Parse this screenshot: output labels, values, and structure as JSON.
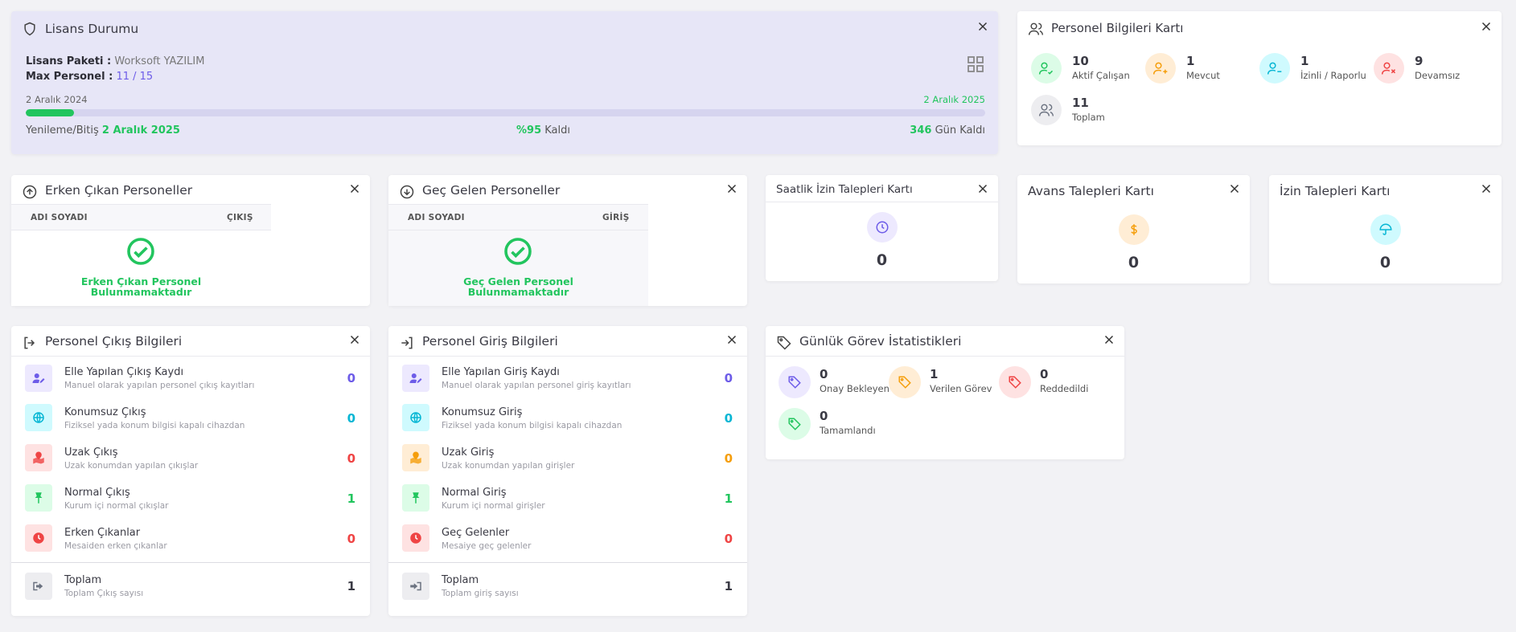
{
  "license": {
    "title": "Lisans Durumu",
    "package_label": "Lisans Paketi :",
    "package_value": "Worksoft YAZILIM",
    "max_label": "Max Personel :",
    "max_value": "11 / 15",
    "start_date": "2 Aralık 2024",
    "end_date": "2 Aralık 2025",
    "progress_fraction": 0.05,
    "renew_label": "Yenileme/Bitiş",
    "renew_date": "2 Aralık 2025",
    "pct_value": "%95",
    "pct_label": "Kaldı",
    "days_value": "346",
    "days_label": "Gün Kaldı"
  },
  "personnel": {
    "title": "Personel Bilgileri Kartı",
    "stats": [
      {
        "value": "10",
        "label": "Aktif Çalışan",
        "icon": "user-check-icon"
      },
      {
        "value": "1",
        "label": "Mevcut",
        "icon": "user-plus-icon"
      },
      {
        "value": "1",
        "label": "İzinli / Raporlu",
        "icon": "user-minus-icon"
      },
      {
        "value": "9",
        "label": "Devamsız",
        "icon": "user-x-icon"
      },
      {
        "value": "11",
        "label": "Toplam",
        "icon": "users-icon"
      }
    ]
  },
  "early_leavers": {
    "title": "Erken Çıkan Personeller",
    "col_name": "ADI SOYADI",
    "col_time": "ÇIKIŞ",
    "empty_line1": "Erken Çıkan Personel",
    "empty_line2": "Bulunmamaktadır"
  },
  "late_comers": {
    "title": "Geç Gelen Personeller",
    "col_name": "ADI SOYADI",
    "col_time": "GİRİŞ",
    "empty_line1": "Geç Gelen Personel",
    "empty_line2": "Bulunmamaktadır"
  },
  "hourly_leave": {
    "title": "Saatlik İzin Talepleri Kartı",
    "value": "0"
  },
  "advance": {
    "title": "Avans Talepleri Kartı",
    "value": "0"
  },
  "leave": {
    "title": "İzin Talepleri Kartı",
    "value": "0"
  },
  "checkout": {
    "title": "Personel Çıkış Bilgileri",
    "rows": [
      {
        "title": "Elle Yapılan Çıkış Kaydı",
        "sub": "Manuel olarak yapılan personel çıkış kayıtları",
        "value": "0"
      },
      {
        "title": "Konumsuz Çıkış",
        "sub": "Fiziksel yada konum bilgisi kapalı cihazdan",
        "value": "0"
      },
      {
        "title": "Uzak Çıkış",
        "sub": "Uzak konumdan yapılan çıkışlar",
        "value": "0"
      },
      {
        "title": "Normal Çıkış",
        "sub": "Kurum içi normal çıkışlar",
        "value": "1"
      },
      {
        "title": "Erken Çıkanlar",
        "sub": "Mesaiden erken çıkanlar",
        "value": "0"
      }
    ],
    "total": {
      "title": "Toplam",
      "sub": "Toplam Çıkış sayısı",
      "value": "1"
    }
  },
  "checkin": {
    "title": "Personel Giriş Bilgileri",
    "rows": [
      {
        "title": "Elle Yapılan Giriş Kaydı",
        "sub": "Manuel olarak yapılan personel giriş kayıtları",
        "value": "0"
      },
      {
        "title": "Konumsuz Giriş",
        "sub": "Fiziksel yada konum bilgisi kapalı cihazdan",
        "value": "0"
      },
      {
        "title": "Uzak Giriş",
        "sub": "Uzak konumdan yapılan girişler",
        "value": "0"
      },
      {
        "title": "Normal Giriş",
        "sub": "Kurum içi normal girişler",
        "value": "1"
      },
      {
        "title": "Geç Gelenler",
        "sub": "Mesaiye geç gelenler",
        "value": "0"
      }
    ],
    "total": {
      "title": "Toplam",
      "sub": "Toplam giriş sayısı",
      "value": "1"
    }
  },
  "tasks": {
    "title": "Günlük Görev İstatistikleri",
    "stats": [
      {
        "value": "0",
        "label": "Onay Bekleyen"
      },
      {
        "value": "1",
        "label": "Verilen Görev"
      },
      {
        "value": "0",
        "label": "Reddedildi"
      },
      {
        "value": "0",
        "label": "Tamamlandı"
      }
    ]
  },
  "colors": {
    "purple": "#6d5ce8",
    "cyan": "#06b6d4",
    "red": "#ef4444",
    "green": "#22c55e",
    "orange": "#f59e0b",
    "gray": "#6b7280"
  }
}
